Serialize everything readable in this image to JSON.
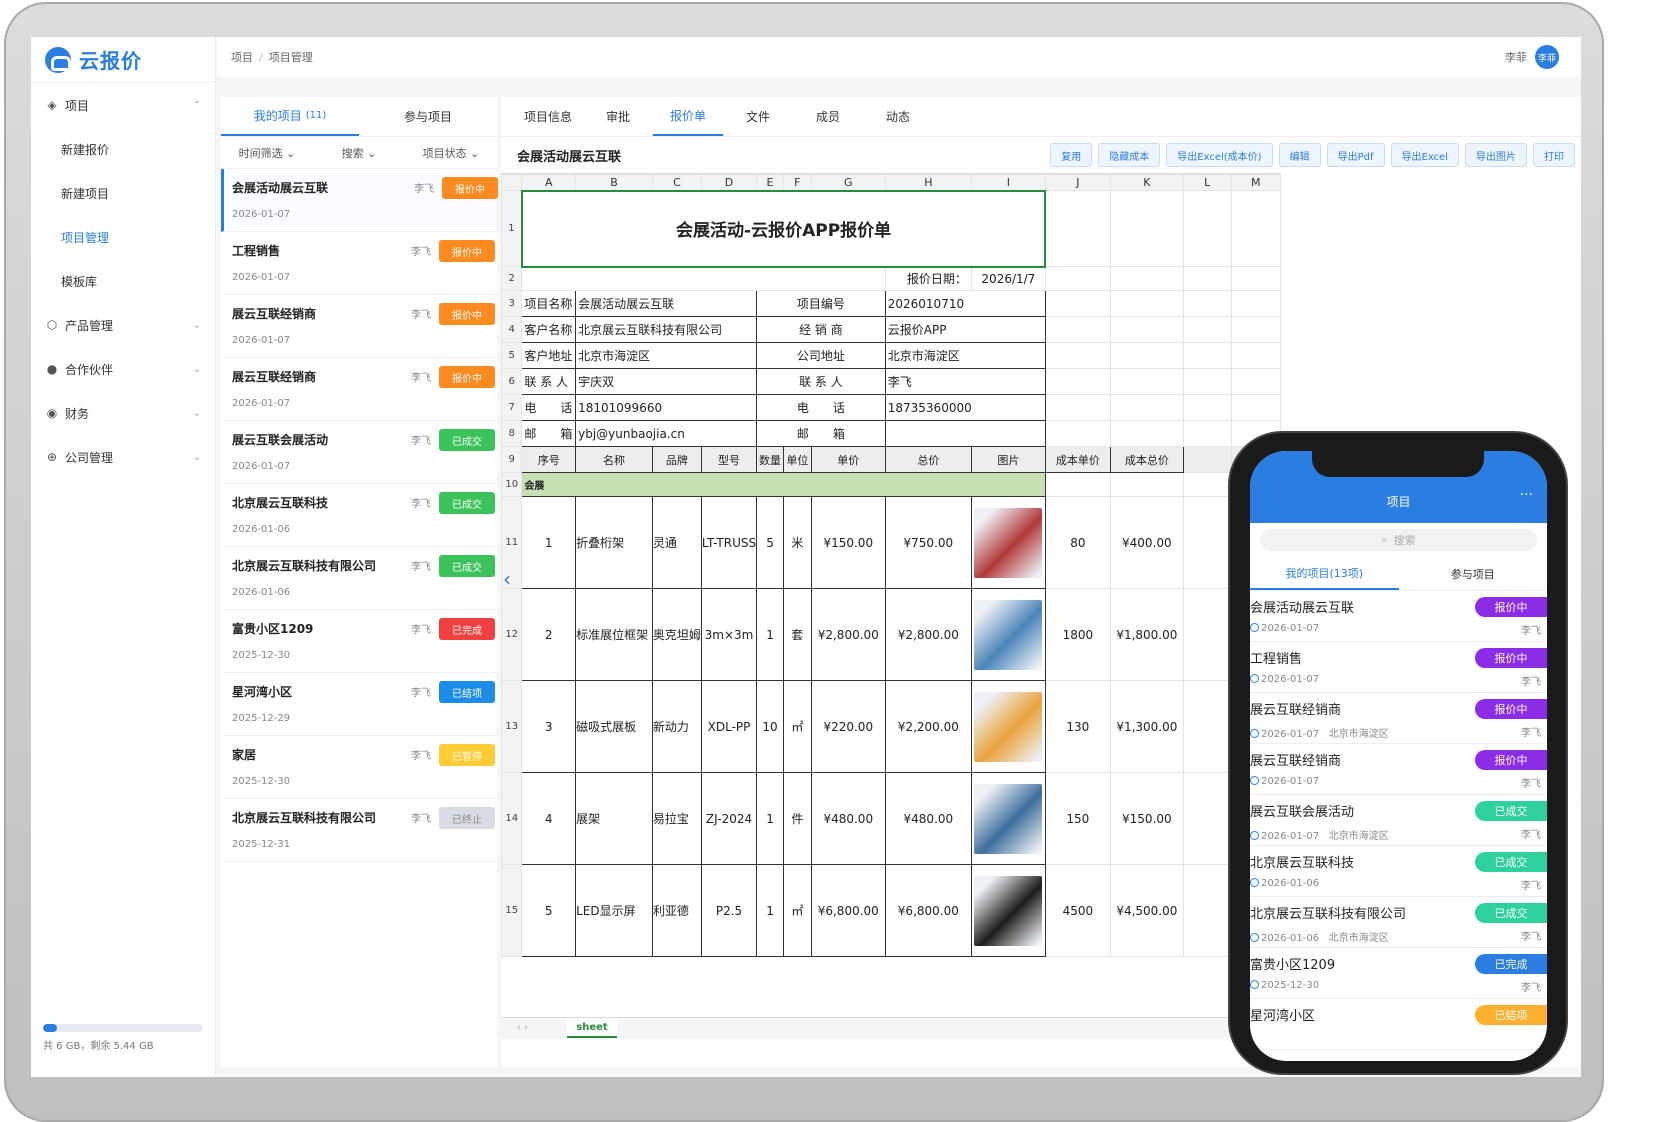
{
  "brand": {
    "name": "云报价"
  },
  "breadcrumb": [
    "项目",
    "项目管理"
  ],
  "user": {
    "name": "李菲",
    "avatar_text": "李菲"
  },
  "sidebar": {
    "groups": [
      {
        "label": "项目",
        "icon": "layers-icon",
        "caret": "up"
      },
      {
        "label": "产品管理",
        "icon": "cube-icon",
        "caret": "down"
      },
      {
        "label": "合作伙伴",
        "icon": "person-icon",
        "caret": "down"
      },
      {
        "label": "财务",
        "icon": "finance-icon",
        "caret": "down"
      },
      {
        "label": "公司管理",
        "icon": "globe-icon",
        "caret": "down"
      }
    ],
    "project_items": [
      "新建报价",
      "新建项目",
      "项目管理",
      "模板库"
    ],
    "active_item": "项目管理",
    "storage": {
      "text": "共 6 GB，剩余 5.44 GB",
      "used_fraction": 0.09
    }
  },
  "project_list": {
    "tabs": [
      {
        "label": "我的项目",
        "count": "(11)"
      },
      {
        "label": "参与项目",
        "count": ""
      }
    ],
    "filters": [
      "时间筛选",
      "搜索",
      "项目状态"
    ],
    "items": [
      {
        "name": "会展活动展云互联",
        "date": "2026-01-07",
        "user": "李飞",
        "status": "报价中",
        "color": "#ff8a1f"
      },
      {
        "name": "工程销售",
        "date": "2026-01-07",
        "user": "李飞",
        "status": "报价中",
        "color": "#ff8a1f"
      },
      {
        "name": "展云互联经销商",
        "date": "2026-01-07",
        "user": "李飞",
        "status": "报价中",
        "color": "#ff8a1f"
      },
      {
        "name": "展云互联经销商",
        "date": "2026-01-07",
        "user": "李飞",
        "status": "报价中",
        "color": "#ff8a1f"
      },
      {
        "name": "展云互联会展活动",
        "date": "2026-01-07",
        "user": "李飞",
        "status": "已成交",
        "color": "#3cc25a"
      },
      {
        "name": "北京展云互联科技",
        "date": "2026-01-06",
        "user": "李飞",
        "status": "已成交",
        "color": "#3cc25a"
      },
      {
        "name": "北京展云互联科技有限公司",
        "date": "2026-01-06",
        "user": "李飞",
        "status": "已成交",
        "color": "#3cc25a"
      },
      {
        "name": "富贵小区1209",
        "date": "2025-12-30",
        "user": "李飞",
        "status": "已完成",
        "color": "#f04040"
      },
      {
        "name": "星河湾小区",
        "date": "2025-12-29",
        "user": "李飞",
        "status": "已结项",
        "color": "#1b8de8"
      },
      {
        "name": "家居",
        "date": "2025-12-30",
        "user": "李飞",
        "status": "已暂停",
        "color": "#ffcc33"
      },
      {
        "name": "北京展云互联科技有限公司",
        "date": "2025-12-31",
        "user": "李飞",
        "status": "已终止",
        "color": "#d9dde3"
      }
    ]
  },
  "main": {
    "tabs": [
      "项目信息",
      "审批",
      "报价单",
      "文件",
      "成员",
      "动态"
    ],
    "active_tab": "报价单",
    "project_name": "会展活动展云互联",
    "buttons": [
      "复用",
      "隐藏成本",
      "导出Excel(成本价)",
      "编辑",
      "导出Pdf",
      "导出Excel",
      "导出图片",
      "打印"
    ]
  },
  "sheet": {
    "columns": [
      "A",
      "B",
      "C",
      "D",
      "E",
      "F",
      "G",
      "H",
      "I",
      "J",
      "K",
      "L",
      "M"
    ],
    "title": "会展活动-云报价APP报价单",
    "date_label": "报价日期：",
    "date_value": "2026/1/7",
    "info_rows": [
      {
        "k1": "项目名称",
        "v1": "会展活动展云互联",
        "k2": "项目编号",
        "v2": "2026010710"
      },
      {
        "k1": "客户名称",
        "v1": "北京展云互联科技有限公司",
        "k2": "经 销 商",
        "v2": "云报价APP"
      },
      {
        "k1": "客户地址",
        "v1": "北京市海淀区",
        "k2": "公司地址",
        "v2": "北京市海淀区"
      },
      {
        "k1": "联 系 人",
        "v1": "宇庆双",
        "k2": "联 系 人",
        "v2": "李飞"
      },
      {
        "k1": "电　　话",
        "v1": "18101099660",
        "k2": "电　　话",
        "v2": "18735360000"
      },
      {
        "k1": "邮　　箱",
        "v1": "ybj@yunbaojia.cn",
        "k2": "邮　　箱",
        "v2": ""
      }
    ],
    "headers": [
      "序号",
      "名称",
      "品牌",
      "型号",
      "数量",
      "单位",
      "单价",
      "总价",
      "图片",
      "成本单价",
      "成本总价"
    ],
    "category": "会展",
    "rows": [
      {
        "no": "1",
        "name": "折叠桁架",
        "brand": "灵通",
        "model": "LT-TRUSS",
        "qty": "5",
        "unit": "米",
        "price": "¥150.00",
        "total": "¥750.00",
        "cost": "80",
        "cost_total": "¥400.00",
        "img": "#b13a3a"
      },
      {
        "no": "2",
        "name": "标准展位框架",
        "brand": "奥克坦姆",
        "model": "3m×3m",
        "qty": "1",
        "unit": "套",
        "price": "¥2,800.00",
        "total": "¥2,800.00",
        "cost": "1800",
        "cost_total": "¥1,800.00",
        "img": "#4a84b8"
      },
      {
        "no": "3",
        "name": "磁吸式展板",
        "brand": "新动力",
        "model": "XDL-PP",
        "qty": "10",
        "unit": "㎡",
        "price": "¥220.00",
        "total": "¥2,200.00",
        "cost": "130",
        "cost_total": "¥1,300.00",
        "img": "#e9a23b"
      },
      {
        "no": "4",
        "name": "展架",
        "brand": "易拉宝",
        "model": "ZJ-2024",
        "qty": "1",
        "unit": "件",
        "price": "¥480.00",
        "total": "¥480.00",
        "cost": "150",
        "cost_total": "¥150.00",
        "img": "#3d6f9c"
      },
      {
        "no": "5",
        "name": "LED显示屏",
        "brand": "利亚德",
        "model": "P2.5",
        "qty": "1",
        "unit": "㎡",
        "price": "¥6,800.00",
        "total": "¥6,800.00",
        "cost": "4500",
        "cost_total": "¥4,500.00",
        "img": "#1c1c1c"
      }
    ],
    "row_numbers": [
      "1",
      "2",
      "3",
      "4",
      "5",
      "6",
      "7",
      "8",
      "9",
      "10",
      "11",
      "12",
      "13",
      "14",
      "15"
    ],
    "sheet_tab": "sheet"
  },
  "mobile": {
    "title": "项目",
    "more": "···",
    "search_placeholder": "搜索",
    "tabs": [
      "我的项目(13项)",
      "参与项目"
    ],
    "items": [
      {
        "name": "会展活动展云互联",
        "date": "2026-01-07",
        "addr": "",
        "user": "李飞",
        "status": "报价中",
        "color": "#8b2ce6"
      },
      {
        "name": "工程销售",
        "date": "2026-01-07",
        "addr": "",
        "user": "李飞",
        "status": "报价中",
        "color": "#8b2ce6"
      },
      {
        "name": "展云互联经销商",
        "date": "2026-01-07",
        "addr": "北京市海淀区",
        "user": "李飞",
        "status": "报价中",
        "color": "#8b2ce6"
      },
      {
        "name": "展云互联经销商",
        "date": "2026-01-07",
        "addr": "",
        "user": "李飞",
        "status": "报价中",
        "color": "#8b2ce6"
      },
      {
        "name": "展云互联会展活动",
        "date": "2026-01-07",
        "addr": "北京市海淀区",
        "user": "李飞",
        "status": "已成交",
        "color": "#2fd0a0"
      },
      {
        "name": "北京展云互联科技",
        "date": "2026-01-06",
        "addr": "",
        "user": "李飞",
        "status": "已成交",
        "color": "#2fd0a0"
      },
      {
        "name": "北京展云互联科技有限公司",
        "date": "2026-01-06",
        "addr": "北京市海淀区",
        "user": "李飞",
        "status": "已成交",
        "color": "#2fd0a0"
      },
      {
        "name": "富贵小区1209",
        "date": "2025-12-30",
        "addr": "",
        "user": "李飞",
        "status": "已完成",
        "color": "#2a7de1"
      },
      {
        "name": "星河湾小区",
        "date": "",
        "addr": "",
        "user": "",
        "status": "已结项",
        "color": "#ffb030"
      }
    ]
  }
}
